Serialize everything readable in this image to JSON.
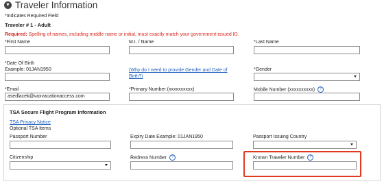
{
  "header": {
    "title": "Traveler Information",
    "required_note": "*Indicates Required Field"
  },
  "traveler": {
    "heading": "Traveler # 1 - Adult"
  },
  "notice": {
    "label": "Required:",
    "text": "Spelling of names, including middle name or initial, must exactly match your government-issued ID."
  },
  "fields": {
    "first_name": {
      "label": "*First Name",
      "value": ""
    },
    "middle": {
      "label": "M.I. / Name",
      "value": ""
    },
    "last_name": {
      "label": "*Last Name",
      "value": ""
    },
    "dob": {
      "label": "*Date Of Birth",
      "example": "Example: 01JAN1950",
      "value": ""
    },
    "why_link": "(Why do I need to provide Gender and Date of Birth?)",
    "gender": {
      "label": "*Gender",
      "value": ""
    },
    "email": {
      "label": "*Email",
      "value": "asedlacek@vaxvacationaccess.com"
    },
    "primary": {
      "label": "*Primary Number",
      "hint": "(xxxxxxxxxx)",
      "value": ""
    },
    "mobile": {
      "label": "Mobile Number",
      "hint": "(xxxxxxxxxx)",
      "value": ""
    }
  },
  "tsa": {
    "title": "TSA Secure Flight Program Information",
    "privacy_link": "TSA Privacy Notice",
    "optional": "Optional TSA Items",
    "passport_number": {
      "label": "Passport Number",
      "value": ""
    },
    "expiry": {
      "label": "Expiry Date Example: 01JAN1950",
      "value": ""
    },
    "issuing_country": {
      "label": "Passport Issuing Country",
      "value": ""
    },
    "citizenship": {
      "label": "Citizenship",
      "value": ""
    },
    "redress": {
      "label": "Redress Number",
      "value": ""
    },
    "known_traveler": {
      "label": "Known Traveler Number",
      "value": ""
    }
  },
  "icons": {
    "header": "chevron-down-circle-icon",
    "help": "question-circle-icon",
    "select": "caret-down-icon"
  },
  "colors": {
    "required": "#d9261c",
    "link": "#1f5fbf",
    "highlight": "#e0391e"
  }
}
